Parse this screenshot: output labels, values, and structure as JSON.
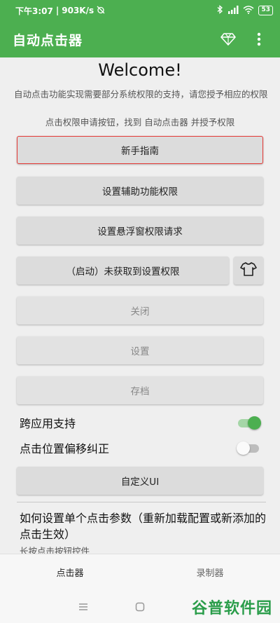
{
  "status": {
    "time": "下午3:07",
    "speed": "903K/s",
    "battery": "53"
  },
  "appbar": {
    "title": "自动点击器"
  },
  "welcome": {
    "title": "Welcome!",
    "desc1": "自动点击功能实现需要部分系统权限的支持，请您授予相应的权限",
    "desc2": "点击权限申请按钮，找到 自动点击器 并授予权限"
  },
  "buttons": {
    "guide": "新手指南",
    "accessibility": "设置辅助功能权限",
    "overlay": "设置悬浮窗权限请求",
    "start": "（启动）未获取到设置权限",
    "close": "关闭",
    "settings": "设置",
    "archive": "存档",
    "custom_ui": "自定义UI"
  },
  "toggles": {
    "cross_app": "跨应用支持",
    "offset": "点击位置偏移纠正"
  },
  "howto": {
    "title": "如何设置单个点击参数（重新加载配置或新添加的点击生效）",
    "sub": "长按点击按钮控件"
  },
  "tabs": {
    "clicker": "点击器",
    "recorder": "录制器"
  },
  "watermark": "谷普软件园",
  "colors": {
    "accent": "#4caf50",
    "highlight_border": "#e53935"
  }
}
